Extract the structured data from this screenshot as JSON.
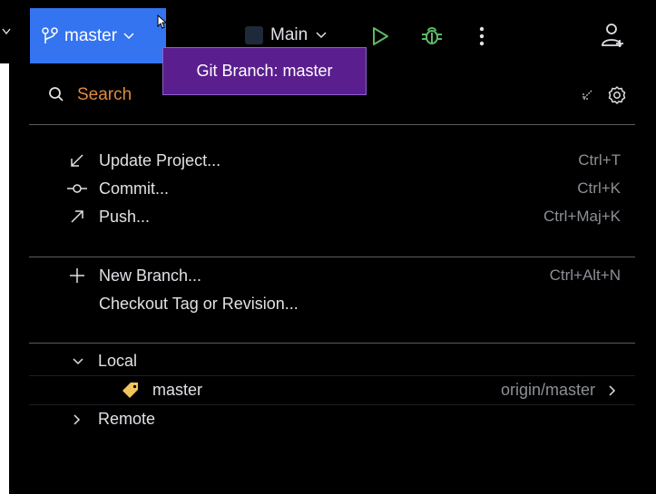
{
  "toolbar": {
    "branch_label": "master",
    "run_config_label": "Main"
  },
  "tooltip": {
    "text": "Git Branch: master"
  },
  "search": {
    "placeholder": "Search"
  },
  "actions": [
    {
      "label": "Update Project...",
      "shortcut": "Ctrl+T",
      "icon": "update-arrow-icon"
    },
    {
      "label": "Commit...",
      "shortcut": "Ctrl+K",
      "icon": "commit-icon"
    },
    {
      "label": "Push...",
      "shortcut": "Ctrl+Maj+K",
      "icon": "push-arrow-icon"
    }
  ],
  "branch_actions": [
    {
      "label": "New Branch...",
      "shortcut": "Ctrl+Alt+N",
      "icon": "plus-icon"
    },
    {
      "label": "Checkout Tag or Revision...",
      "shortcut": ""
    }
  ],
  "tree": {
    "local_label": "Local",
    "local_branch": {
      "name": "master",
      "tracking": "origin/master"
    },
    "remote_label": "Remote"
  },
  "colors": {
    "branch_widget": "#3574f0",
    "tooltip_bg": "#5a1e8e",
    "search_placeholder": "#e08a3c",
    "run_green": "#5fb865",
    "tag_yellow": "#f2c55c"
  }
}
